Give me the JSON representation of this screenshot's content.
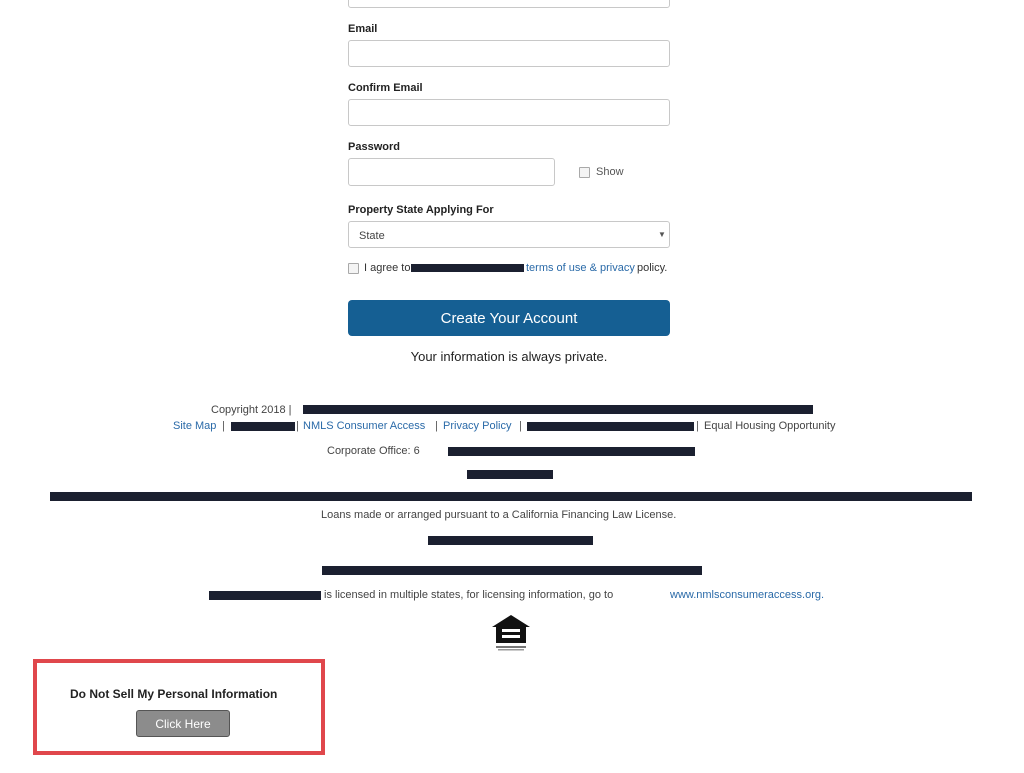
{
  "form": {
    "email_label": "Email",
    "confirm_email_label": "Confirm Email",
    "password_label": "Password",
    "show_label": "Show",
    "state_label": "Property State Applying For",
    "state_selected": "State",
    "agree_prefix": "I agree to",
    "terms_link": "terms of use & privacy",
    "agree_suffix": "policy.",
    "create_button": "Create Your Account",
    "privacy_note": "Your information is always private."
  },
  "footer": {
    "copyright": "Copyright 2018 |",
    "site_map": "Site Map",
    "pipe": "|",
    "nmls_link": "NMLS Consumer Access",
    "privacy_link": "Privacy Policy",
    "equal_housing": "Equal Housing Opportunity",
    "corporate_office": "Corporate Office: 6",
    "loans_note": "Loans made or arranged pursuant to a California Financing Law License.",
    "licensed_text": "is licensed in multiple states, for licensing information, go to",
    "nmls_url": "www.nmlsconsumeraccess.org.",
    "equal_housing_icon": "equal-housing-icon"
  },
  "do_not_sell": {
    "title": "Do Not Sell My Personal Information",
    "button": "Click Here",
    "highlight_color": "#e0474c"
  },
  "colors": {
    "primary": "#155f93",
    "link": "#2a6aa8",
    "redaction": "#1b2030"
  }
}
